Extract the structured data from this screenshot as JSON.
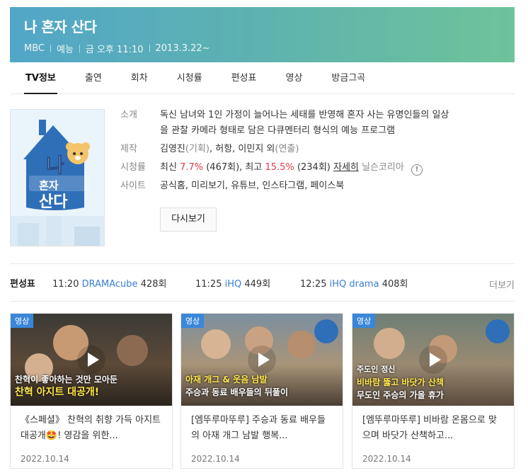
{
  "header": {
    "title": "나 혼자 산다",
    "meta": [
      "MBC",
      "예능",
      "금 오후 11:10",
      "2013.3.22~"
    ]
  },
  "tabs": [
    "TV정보",
    "출연",
    "회차",
    "시청률",
    "편성표",
    "영상",
    "방금그곡"
  ],
  "poster": {
    "line1": "나",
    "line2": "혼자",
    "line3": "산다"
  },
  "info": {
    "intro_label": "소개",
    "intro_line1": "독신 남녀와 1인 가정이 늘어나는 세태를 반영해 혼자 사는 유명인들의 일상",
    "intro_line2": "을 관찰 카메라 형태로 담은 다큐멘터리 형식의 예능 프로그램",
    "prod_label": "제작",
    "prod_value": "김영진",
    "prod_role1": "(기획)",
    "prod_value2": ", 허항, 이민지 외",
    "prod_role2": "(연출)",
    "rating_label": "시청률",
    "rating_low_label": "최신",
    "rating_low": "7.7%",
    "rating_low_ep": "(467회)",
    "rating_high_label": ", 최고",
    "rating_high": "15.5%",
    "rating_high_ep": "(234회)",
    "rating_detail": "자세히",
    "rating_source": "닐슨코리아",
    "site_label": "사이트",
    "sites": "공식홈, 미리보기, 유튜브, 인스타그램, 페이스북",
    "replay": "다시보기"
  },
  "schedule": {
    "label": "편성표",
    "items": [
      {
        "time": "11:20",
        "channel": "DRAMAcube",
        "ep": "428회"
      },
      {
        "time": "11:25",
        "channel": "iHQ",
        "ep": "449회"
      },
      {
        "time": "12:25",
        "channel": "iHQ drama",
        "ep": "408회"
      }
    ],
    "more": "더보기"
  },
  "videos": [
    {
      "badge": "영상",
      "caption_top": "찬혁이 좋아하는 것만 모아둔",
      "caption_bottom": "찬혁 아지트 대공개!",
      "title": "《스페셜》 찬혁의 취향 가득 아지트 대공개🤩! 영감을 위한...",
      "date": "2022.10.14"
    },
    {
      "badge": "영상",
      "caption_top": "아재 개그 & 웃음 남발",
      "caption_bottom": "주승과 동료 배우들의 뒤풀이",
      "title": "[엠뚜루마뚜루] 주승과 동료 배우들의 아재 개그 남발 행복...",
      "date": "2022.10.14"
    },
    {
      "badge": "영상",
      "caption_top": "주도인 정신",
      "caption_mid": "비바람 뚫고 바닷가 산책",
      "caption_bottom": "무도인 주승의 가을 휴가",
      "title": "[엠뚜루마뚜루] 비바람 온몸으로 맞으며 바닷가 산책하고...",
      "date": "2022.10.14"
    }
  ],
  "colors": {
    "header_start": "#52a6c8",
    "header_end": "#6fc39a",
    "rating_red": "#e0394b",
    "link_blue": "#3a3aa8",
    "badge_blue": "#3a87d9"
  }
}
